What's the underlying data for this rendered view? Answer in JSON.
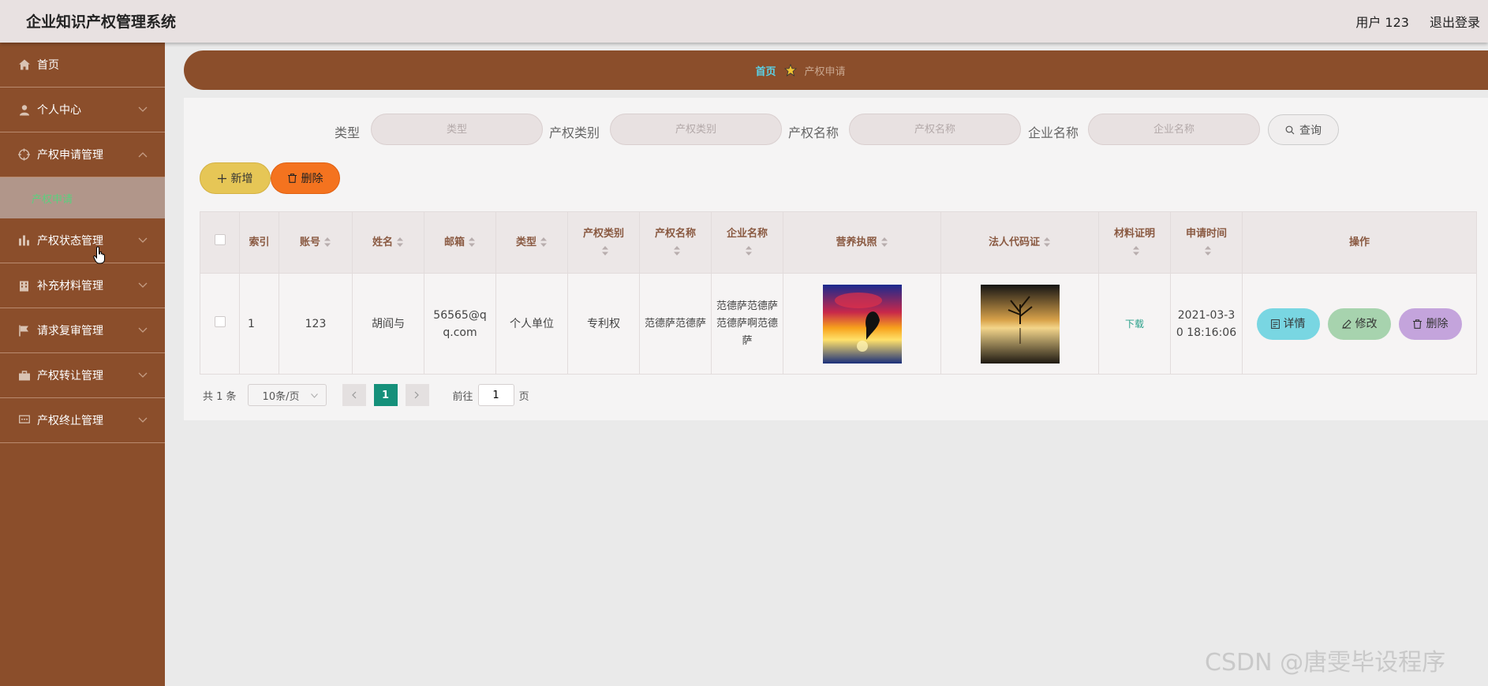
{
  "header": {
    "title": "企业知识产权管理系统",
    "user": "用户 123",
    "logout": "退出登录"
  },
  "sidebar": {
    "items": [
      {
        "label": "首页",
        "icon": "home-icon"
      },
      {
        "label": "个人中心",
        "icon": "user-icon"
      },
      {
        "label": "产权申请管理",
        "icon": "target-icon",
        "expanded": true,
        "sub": "产权申请"
      },
      {
        "label": "产权状态管理",
        "icon": "chart-icon"
      },
      {
        "label": "补充材料管理",
        "icon": "building-icon"
      },
      {
        "label": "请求复审管理",
        "icon": "flag-icon"
      },
      {
        "label": "产权转让管理",
        "icon": "bag-icon"
      },
      {
        "label": "产权终止管理",
        "icon": "chat-icon"
      }
    ]
  },
  "breadcrumb": {
    "home": "首页",
    "current": "产权申请"
  },
  "search": {
    "fields": [
      {
        "label": "类型",
        "placeholder": "类型"
      },
      {
        "label": "产权类别",
        "placeholder": "产权类别"
      },
      {
        "label": "产权名称",
        "placeholder": "产权名称"
      },
      {
        "label": "企业名称",
        "placeholder": "企业名称"
      }
    ],
    "button": "查询"
  },
  "actions": {
    "add": "新增",
    "delete": "删除"
  },
  "table": {
    "headers": {
      "index": "索引",
      "account": "账号",
      "name": "姓名",
      "email": "邮箱",
      "type": "类型",
      "category": "产权类别",
      "ip_name": "产权名称",
      "company": "企业名称",
      "license": "营养执照",
      "legal_code": "法人代码证",
      "material": "材料证明",
      "apply_time": "申请时间",
      "ops": "操作"
    },
    "rows": [
      {
        "index": "1",
        "account": "123",
        "name": "胡阎与",
        "email": "56565@qq.com",
        "type": "个人单位",
        "category": "专利权",
        "ip_name": "范德萨范德萨",
        "company": "范德萨范德萨范德萨啊范德萨",
        "material": "下载",
        "apply_time": "2021-03-30 18:16:06"
      }
    ],
    "row_ops": {
      "detail": "详情",
      "edit": "修改",
      "remove": "删除"
    }
  },
  "pagination": {
    "total": "共 1 条",
    "page_size": "10条/页",
    "current_page": "1",
    "goto_prefix": "前往",
    "goto_value": "1",
    "goto_suffix": "页"
  },
  "watermark": "CSDN @唐雯毕设程序",
  "colors": {
    "sidebar": "#8b4e2b",
    "header": "#e8e1e1",
    "accent_green": "#15907a",
    "add": "#e6c656",
    "delete": "#f4731f"
  }
}
